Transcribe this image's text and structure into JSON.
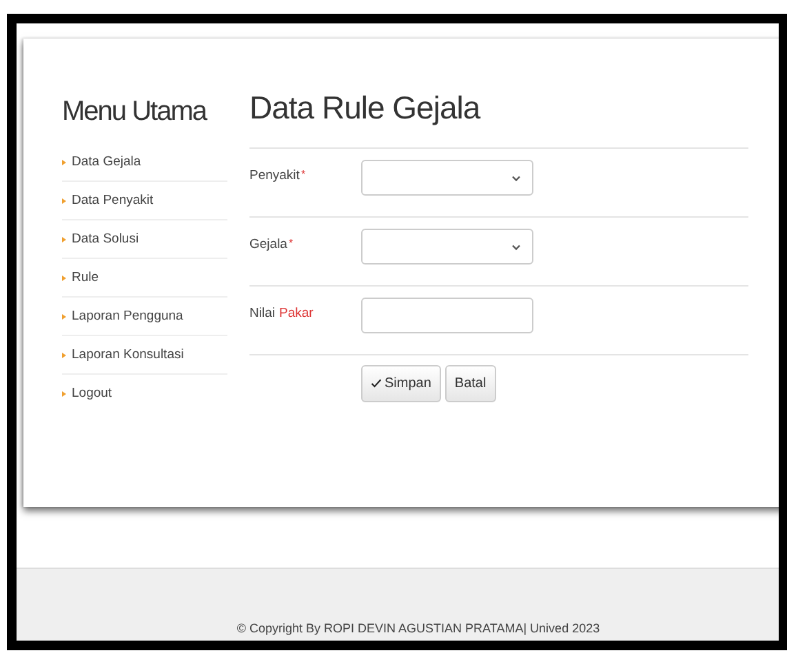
{
  "sidebar": {
    "title": "Menu Utama",
    "items": [
      {
        "label": "Data Gejala"
      },
      {
        "label": "Data Penyakit"
      },
      {
        "label": "Data Solusi"
      },
      {
        "label": "Rule"
      },
      {
        "label": "Laporan Pengguna"
      },
      {
        "label": "Laporan Konsultasi"
      },
      {
        "label": "Logout"
      }
    ]
  },
  "main": {
    "title": "Data Rule Gejala",
    "fields": [
      {
        "label": "Penyakit",
        "note": "*",
        "kind": "select"
      },
      {
        "label": "Gejala",
        "note": "*",
        "kind": "select"
      },
      {
        "label": "Nilai",
        "note": "Pakar",
        "kind": "input"
      }
    ],
    "buttons": [
      {
        "label": "Simpan",
        "kind": "submit"
      },
      {
        "label": "Batal",
        "kind": "cancel"
      }
    ]
  },
  "footer": {
    "text": "© Copyright By ROPI DEVIN AGUSTIAN PRATAMA| Unived 2023"
  }
}
